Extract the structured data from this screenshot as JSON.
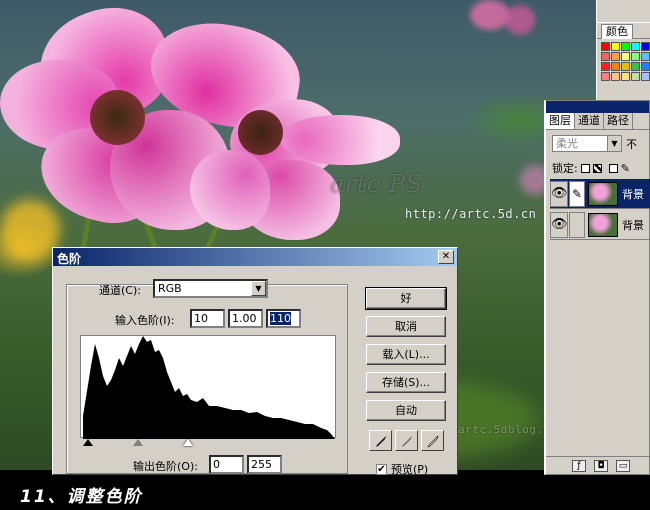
{
  "photo": {
    "watermark_url": "http://artc.5d.cn",
    "watermark_blog": "artc.5dblog.com",
    "watermark_big": "artc PS"
  },
  "color_panel": {
    "tab_label": "颜色",
    "swatch_colors": [
      "#ff0000",
      "#ffff00",
      "#00ff00",
      "#00ffff",
      "#0000ff",
      "#ff6060",
      "#ffa040",
      "#ffff80",
      "#80ff80",
      "#60c0ff",
      "#ff2020",
      "#ff8000",
      "#e0c000",
      "#40c040",
      "#2080ff",
      "#ff8080",
      "#ffc080",
      "#ffe080",
      "#c0e0a0",
      "#a0c0ff"
    ]
  },
  "layers_panel": {
    "tabs": [
      "图层",
      "通道",
      "路径"
    ],
    "blend_mode": "柔光",
    "opacity_label": "不",
    "lock_label": "锁定:",
    "layers": [
      {
        "name": "背景",
        "selected": true
      },
      {
        "name": "背景",
        "selected": false
      }
    ]
  },
  "levels_dialog": {
    "title": "色阶",
    "channel_label": "通道(C):",
    "channel_value": "RGB",
    "input_label": "输入色阶(I):",
    "input_black": "10",
    "input_gamma": "1.00",
    "input_white": "110",
    "output_label": "输出色阶(O):",
    "output_black": "0",
    "output_white": "255",
    "buttons": {
      "ok": "好",
      "cancel": "取消",
      "load": "载入(L)...",
      "save": "存储(S)...",
      "auto": "自动"
    },
    "preview_label": "预览(P)",
    "preview_checked": true
  },
  "caption": "11、调整色阶"
}
